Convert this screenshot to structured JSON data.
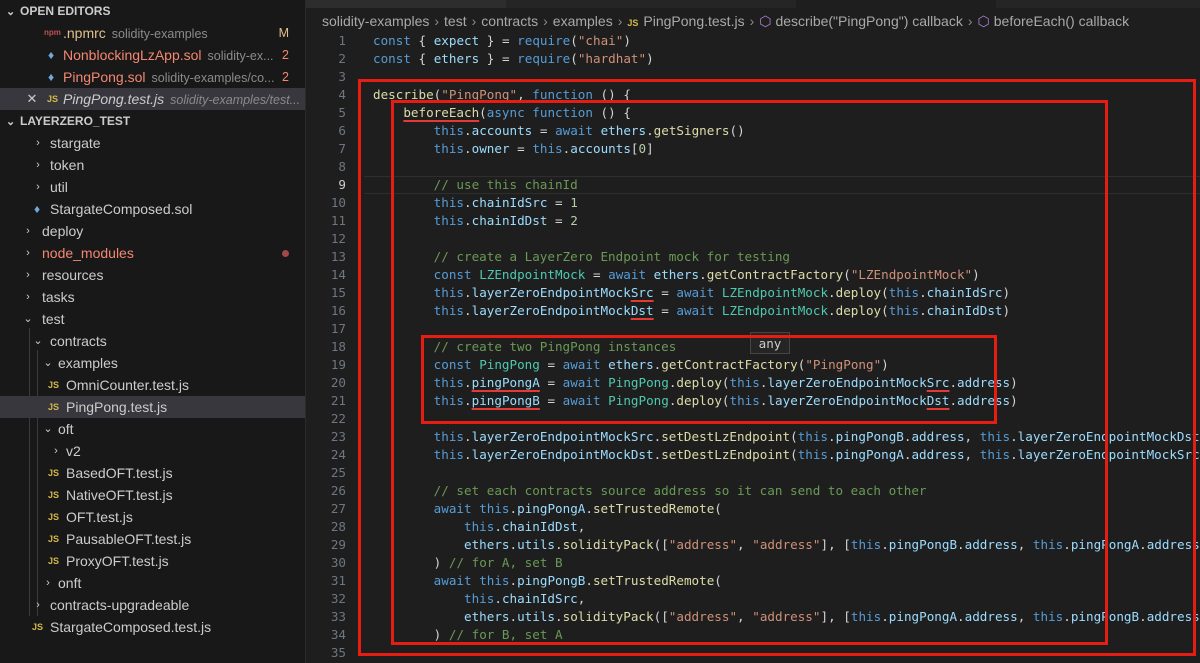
{
  "sidebar": {
    "open_editors_label": "OPEN EDITORS",
    "open_editors": [
      {
        "icon": "npm-icon",
        "name": ".npmrc",
        "desc": "solidity-examples",
        "badge": "M"
      },
      {
        "icon": "solidity-file-icon",
        "name": "NonblockingLzApp.sol",
        "desc": "solidity-ex...",
        "badge": "2"
      },
      {
        "icon": "solidity-file-icon",
        "name": "PingPong.sol",
        "desc": "solidity-examples/co...",
        "badge": "2"
      },
      {
        "icon": "js-file-icon",
        "icon_text": "JS",
        "name": "PingPong.test.js",
        "desc": "solidity-examples/test..."
      }
    ],
    "project_label": "LAYERZERO_TEST",
    "tree": [
      {
        "name": "stargate",
        "icon": "chevron-right-icon"
      },
      {
        "name": "token",
        "icon": "chevron-right-icon"
      },
      {
        "name": "util",
        "icon": "chevron-right-icon"
      },
      {
        "name": "StargateComposed.sol",
        "icon": "solidity-file-icon"
      },
      {
        "name": "deploy",
        "icon": "chevron-right-icon"
      },
      {
        "name": "node_modules",
        "icon": "chevron-right-icon"
      },
      {
        "name": "resources",
        "icon": "chevron-right-icon"
      },
      {
        "name": "tasks",
        "icon": "chevron-right-icon"
      },
      {
        "name": "test",
        "icon": "chevron-down-icon"
      },
      {
        "name": "contracts",
        "icon": "chevron-down-icon"
      },
      {
        "name": "examples",
        "icon": "chevron-down-icon"
      },
      {
        "name": "OmniCounter.test.js",
        "icon": "js-file-icon",
        "icon_text": "JS"
      },
      {
        "name": "PingPong.test.js",
        "icon": "js-file-icon",
        "icon_text": "JS"
      },
      {
        "name": "oft",
        "icon": "chevron-down-icon"
      },
      {
        "name": "v2",
        "icon": "chevron-right-icon"
      },
      {
        "name": "BasedOFT.test.js",
        "icon": "js-file-icon",
        "icon_text": "JS"
      },
      {
        "name": "NativeOFT.test.js",
        "icon": "js-file-icon",
        "icon_text": "JS"
      },
      {
        "name": "OFT.test.js",
        "icon": "js-file-icon",
        "icon_text": "JS"
      },
      {
        "name": "PausableOFT.test.js",
        "icon": "js-file-icon",
        "icon_text": "JS"
      },
      {
        "name": "ProxyOFT.test.js",
        "icon": "js-file-icon",
        "icon_text": "JS"
      },
      {
        "name": "onft",
        "icon": "chevron-right-icon"
      },
      {
        "name": "contracts-upgradeable",
        "icon": "chevron-right-icon"
      },
      {
        "name": "StargateComposed.test.js",
        "icon": "js-file-icon",
        "icon_text": "JS"
      }
    ]
  },
  "breadcrumb": {
    "items": [
      "solidity-examples",
      "test",
      "contracts",
      "examples"
    ],
    "file_icon_text": "JS",
    "file": "PingPong.test.js",
    "symbol1": "describe(\"PingPong\") callback",
    "symbol2": "beforeEach() callback"
  },
  "editor": {
    "hover_text": "any",
    "current_line": 9,
    "lines": [
      {
        "n": 1,
        "t": "const { expect } = require(\"chai\")"
      },
      {
        "n": 2,
        "t": "const { ethers } = require(\"hardhat\")"
      },
      {
        "n": 3,
        "t": ""
      },
      {
        "n": 4,
        "t": "describe(\"PingPong\", function () {"
      },
      {
        "n": 5,
        "t": "    beforeEach(async function () {"
      },
      {
        "n": 6,
        "t": "        this.accounts = await ethers.getSigners()"
      },
      {
        "n": 7,
        "t": "        this.owner = this.accounts[0]"
      },
      {
        "n": 8,
        "t": ""
      },
      {
        "n": 9,
        "t": "        // use this chainId"
      },
      {
        "n": 10,
        "t": "        this.chainIdSrc = 1"
      },
      {
        "n": 11,
        "t": "        this.chainIdDst = 2"
      },
      {
        "n": 12,
        "t": ""
      },
      {
        "n": 13,
        "t": "        // create a LayerZero Endpoint mock for testing"
      },
      {
        "n": 14,
        "t": "        const LZEndpointMock = await ethers.getContractFactory(\"LZEndpointMock\")"
      },
      {
        "n": 15,
        "t": "        this.layerZeroEndpointMockSrc = await LZEndpointMock.deploy(this.chainIdSrc)"
      },
      {
        "n": 16,
        "t": "        this.layerZeroEndpointMockDst = await LZEndpointMock.deploy(this.chainIdDst)"
      },
      {
        "n": 17,
        "t": ""
      },
      {
        "n": 18,
        "t": "        // create two PingPong instances"
      },
      {
        "n": 19,
        "t": "        const PingPong = await ethers.getContractFactory(\"PingPong\")"
      },
      {
        "n": 20,
        "t": "        this.pingPongA = await PingPong.deploy(this.layerZeroEndpointMockSrc.address)"
      },
      {
        "n": 21,
        "t": "        this.pingPongB = await PingPong.deploy(this.layerZeroEndpointMockDst.address)"
      },
      {
        "n": 22,
        "t": ""
      },
      {
        "n": 23,
        "t": "        this.layerZeroEndpointMockSrc.setDestLzEndpoint(this.pingPongB.address, this.layerZeroEndpointMockDst.addr"
      },
      {
        "n": 24,
        "t": "        this.layerZeroEndpointMockDst.setDestLzEndpoint(this.pingPongA.address, this.layerZeroEndpointMockSrc.addr"
      },
      {
        "n": 25,
        "t": ""
      },
      {
        "n": 26,
        "t": "        // set each contracts source address so it can send to each other"
      },
      {
        "n": 27,
        "t": "        await this.pingPongA.setTrustedRemote("
      },
      {
        "n": 28,
        "t": "            this.chainIdDst,"
      },
      {
        "n": 29,
        "t": "            ethers.utils.solidityPack([\"address\", \"address\"], [this.pingPongB.address, this.pingPongA.address])"
      },
      {
        "n": 30,
        "t": "        ) // for A, set B"
      },
      {
        "n": 31,
        "t": "        await this.pingPongB.setTrustedRemote("
      },
      {
        "n": 32,
        "t": "            this.chainIdSrc,"
      },
      {
        "n": 33,
        "t": "            ethers.utils.solidityPack([\"address\", \"address\"], [this.pingPongA.address, this.pingPongB.address])"
      },
      {
        "n": 34,
        "t": "        ) // for B, set A"
      },
      {
        "n": 35,
        "t": ""
      }
    ]
  },
  "colors": {
    "annotation_red": "#e51d12",
    "keyword": "#569cd6",
    "string": "#ce9178",
    "comment": "#6a9955",
    "variable": "#9cdcfe",
    "function": "#dcdcaa"
  }
}
